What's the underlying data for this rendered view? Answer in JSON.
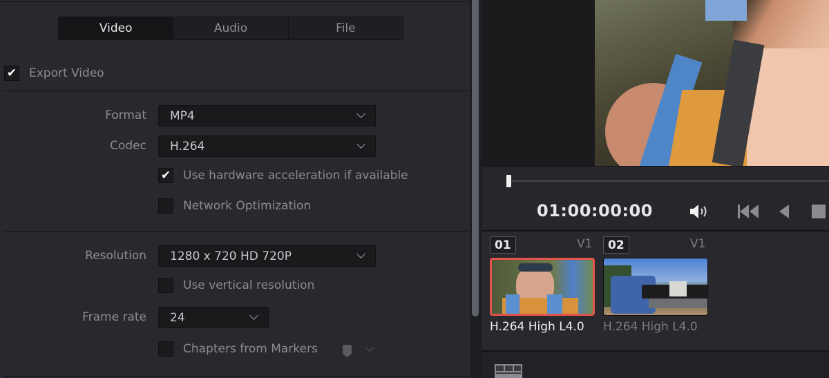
{
  "tabs": [
    {
      "label": "Video",
      "active": true
    },
    {
      "label": "Audio",
      "active": false
    },
    {
      "label": "File",
      "active": false
    }
  ],
  "export_video": {
    "label": "Export Video",
    "checked": true,
    "check_glyph": "✔"
  },
  "format": {
    "label": "Format",
    "value": "MP4"
  },
  "codec": {
    "label": "Codec",
    "value": "H.264"
  },
  "hw_accel": {
    "label": "Use hardware acceleration if available",
    "checked": true,
    "check_glyph": "✔"
  },
  "network_opt": {
    "label": "Network Optimization",
    "checked": false
  },
  "resolution": {
    "label": "Resolution",
    "value": "1280 x 720 HD 720P"
  },
  "vertical_res": {
    "label": "Use vertical resolution",
    "checked": false
  },
  "frame_rate": {
    "label": "Frame rate",
    "value": "24"
  },
  "chapters": {
    "label": "Chapters from Markers",
    "checked": false,
    "marker_icon": "marker-flag-icon"
  },
  "viewer": {
    "timecode": "01:00:00:00",
    "playhead_fraction": 0.0,
    "icons": [
      "volume-icon",
      "skip-to-start-icon",
      "play-reverse-icon",
      "stop-icon"
    ]
  },
  "clips": [
    {
      "number": "01",
      "track": "V1",
      "caption": "H.264 High L4.0",
      "selected": true
    },
    {
      "number": "02",
      "track": "V1",
      "caption": "H.264 High L4.0",
      "selected": false
    }
  ],
  "colors": {
    "selected_clip_border": "#e5534b",
    "panel": "#28282e",
    "accent_text": "#e8e8ec"
  }
}
